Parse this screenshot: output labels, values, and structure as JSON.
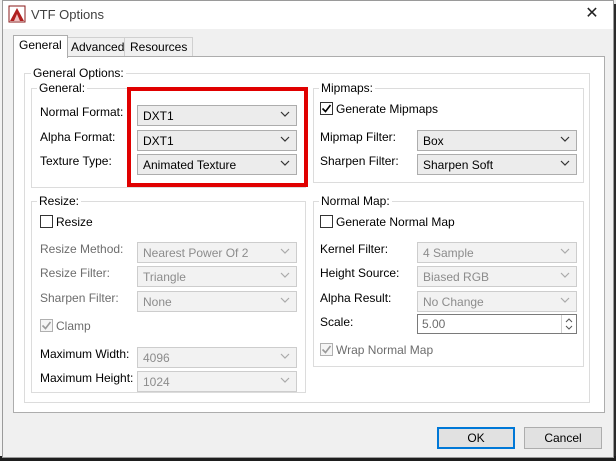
{
  "window": {
    "title": "VTF Options",
    "close_glyph": "✕"
  },
  "tabs": [
    {
      "label": "General",
      "active": true
    },
    {
      "label": "Advanced",
      "active": false
    },
    {
      "label": "Resources",
      "active": false
    }
  ],
  "general_options": {
    "label": "General Options:",
    "general": {
      "label": "General:",
      "normal_format": {
        "label": "Normal Format:",
        "value": "DXT1"
      },
      "alpha_format": {
        "label": "Alpha Format:",
        "value": "DXT1"
      },
      "texture_type": {
        "label": "Texture Type:",
        "value": "Animated Texture"
      }
    },
    "mipmaps": {
      "label": "Mipmaps:",
      "generate": {
        "label": "Generate Mipmaps",
        "checked": true
      },
      "filter": {
        "label": "Mipmap Filter:",
        "value": "Box"
      },
      "sharpen": {
        "label": "Sharpen Filter:",
        "value": "Sharpen Soft"
      }
    },
    "resize": {
      "label": "Resize:",
      "resize_check": {
        "label": "Resize",
        "checked": false
      },
      "method": {
        "label": "Resize Method:",
        "value": "Nearest Power Of 2"
      },
      "filter": {
        "label": "Resize Filter:",
        "value": "Triangle"
      },
      "sharpen": {
        "label": "Sharpen Filter:",
        "value": "None"
      },
      "clamp": {
        "label": "Clamp",
        "checked": true
      },
      "max_width": {
        "label": "Maximum Width:",
        "value": "4096"
      },
      "max_height": {
        "label": "Maximum Height:",
        "value": "1024"
      }
    },
    "normal_map": {
      "label": "Normal Map:",
      "generate": {
        "label": "Generate Normal Map",
        "checked": false
      },
      "kernel": {
        "label": "Kernel Filter:",
        "value": "4 Sample"
      },
      "height_source": {
        "label": "Height Source:",
        "value": "Biased RGB"
      },
      "alpha_result": {
        "label": "Alpha Result:",
        "value": "No Change"
      },
      "scale": {
        "label": "Scale:",
        "value": "5.00"
      },
      "wrap": {
        "label": "Wrap Normal Map",
        "checked": true
      }
    }
  },
  "buttons": {
    "ok": "OK",
    "cancel": "Cancel"
  },
  "colors": {
    "highlight": "#e00000",
    "accent": "#0078d7"
  }
}
